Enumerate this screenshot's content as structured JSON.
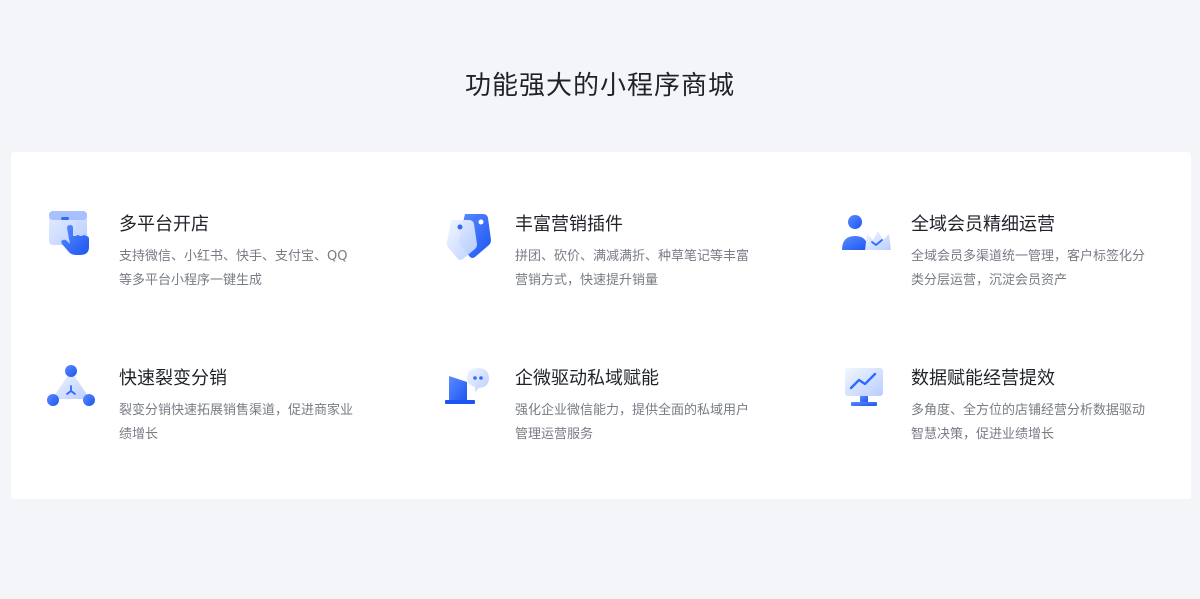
{
  "section": {
    "title": "功能强大的小程序商城"
  },
  "colors": {
    "background": "#f4f5f9",
    "card": "#ffffff",
    "accent": "#2e6bff",
    "title_text": "#1f2329",
    "desc_text": "#777c85"
  },
  "features": [
    {
      "icon": "tap-hand-icon",
      "title": "多平台开店",
      "desc": "支持微信、小红书、快手、支付宝、QQ等多平台小程序一键生成"
    },
    {
      "icon": "price-tag-icon",
      "title": "丰富营销插件",
      "desc": "拼团、砍价、满减满折、种草笔记等丰富营销方式，快速提升销量"
    },
    {
      "icon": "member-crown-icon",
      "title": "全域会员精细运营",
      "desc": "全域会员多渠道统一管理，客户标签化分类分层运营，沉淀会员资产"
    },
    {
      "icon": "share-network-icon",
      "title": "快速裂变分销",
      "desc": "裂变分销快速拓展销售渠道，促进商家业绩增长"
    },
    {
      "icon": "enterprise-chat-icon",
      "title": "企微驱动私域赋能",
      "desc": "强化企业微信能力，提供全面的私域用户管理运营服务"
    },
    {
      "icon": "data-chart-icon",
      "title": "数据赋能经营提效",
      "desc": "多角度、全方位的店铺经营分析数据驱动智慧决策，促进业绩增长"
    }
  ]
}
